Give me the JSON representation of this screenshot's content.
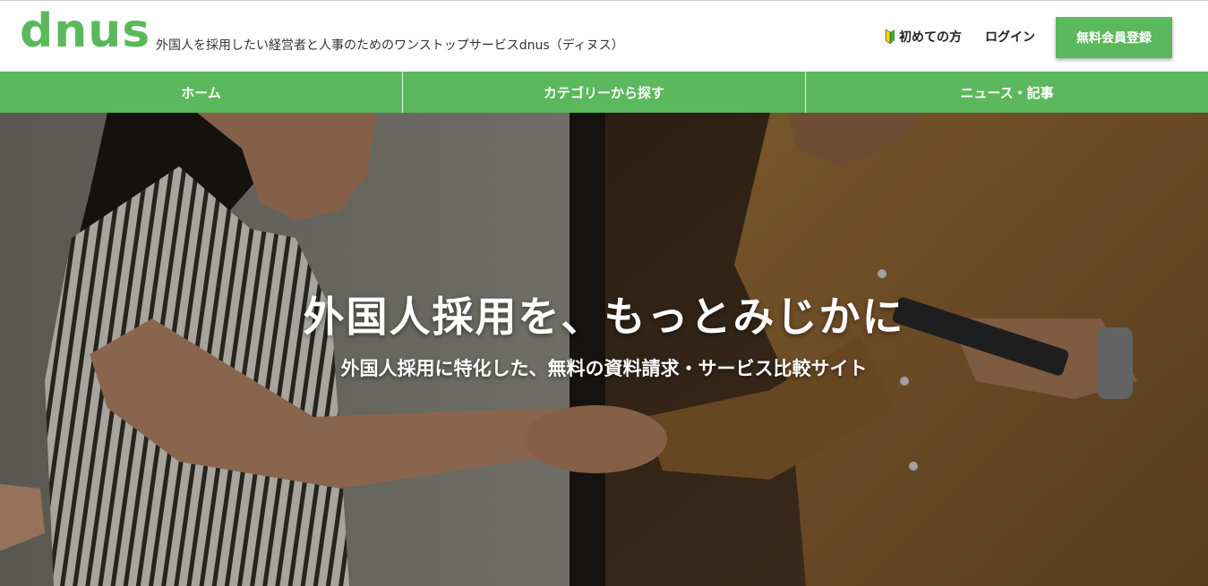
{
  "header": {
    "logo_text": "dnus",
    "tagline": "外国人を採用したい経営者と人事のためのワンストップサービスdnus（ディヌス）",
    "beginner_label": "初めての方",
    "beginner_icon": "beginner-mark-icon",
    "login_label": "ログイン",
    "register_label": "無料会員登録"
  },
  "nav": {
    "items": [
      {
        "label": "ホーム"
      },
      {
        "label": "カテゴリーから探す"
      },
      {
        "label": "ニュース・記事"
      }
    ]
  },
  "hero": {
    "title": "外国人採用を、もっとみじかに",
    "subtitle": "外国人採用に特化した、無料の資料請求・サービス比較サイト"
  },
  "colors": {
    "brand_green": "#5cb85c",
    "nav_text": "#ffffff"
  }
}
